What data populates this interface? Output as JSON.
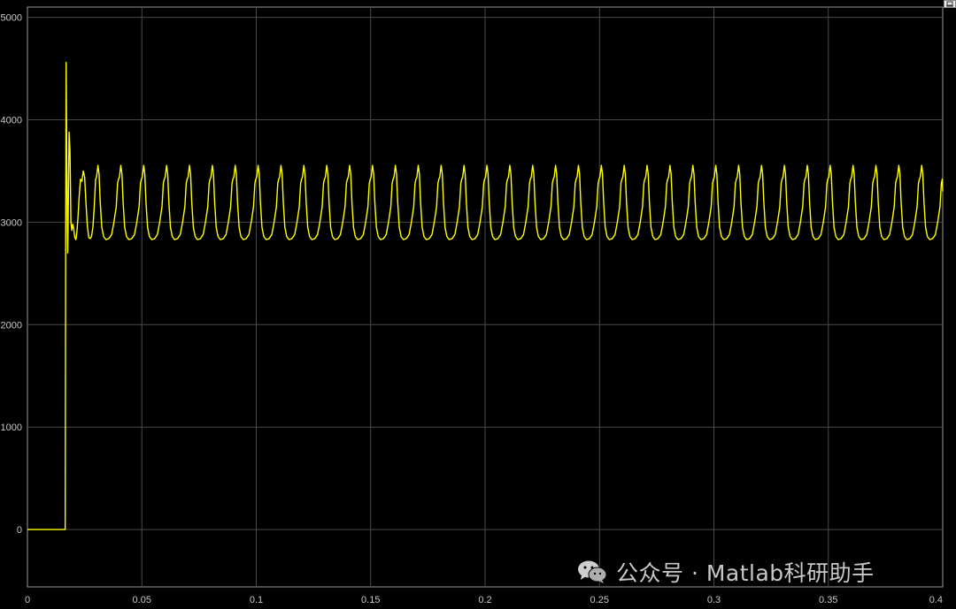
{
  "chart_data": {
    "type": "line",
    "title": "",
    "xlabel": "",
    "ylabel": "",
    "xlim": [
      0,
      0.4
    ],
    "ylim": [
      -560,
      5100
    ],
    "xticks": [
      0,
      0.05,
      0.1,
      0.15,
      0.2,
      0.25,
      0.3,
      0.35,
      0.4
    ],
    "xtick_labels": [
      "0",
      "0.05",
      "0.1",
      "0.15",
      "0.2",
      "0.25",
      "0.3",
      "0.35",
      "0.4"
    ],
    "yticks": [
      0,
      1000,
      2000,
      3000,
      4000,
      5000
    ],
    "ytick_labels": [
      "0",
      "1000",
      "2000",
      "3000",
      "4000",
      "5000"
    ],
    "grid": true,
    "background": "#000000",
    "series": [
      {
        "color": "#ffff00",
        "x": [
          0,
          0.0165,
          0.0167,
          0.0169,
          0.0171,
          0.0174,
          0.0176,
          0.0179,
          0.0182,
          0.0186,
          0.019,
          0.0194,
          0.0198,
          0.0202,
          0.0207,
          0.0212,
          0.0216,
          0.0221,
          0.0226,
          0.0232,
          0.0238,
          0.0244,
          0.025,
          0.0256,
          0.0262,
          0.0268,
          0.0274,
          0.028,
          0.0286,
          0.0292,
          0.0298
        ],
        "y": [
          0,
          0,
          2600,
          4560,
          3900,
          3050,
          2700,
          3250,
          3880,
          3700,
          3000,
          2920,
          2980,
          2940,
          2850,
          2830,
          2900,
          3050,
          3250,
          3420,
          3400,
          3500,
          3440,
          3180,
          2960,
          2850,
          2840,
          2860,
          2950,
          3150,
          3420
        ]
      }
    ],
    "steady_state": {
      "t_start": 0.0298,
      "t_end": 0.4,
      "period": 0.01,
      "y_min": 2830,
      "y_shoulder": 3420,
      "y_peak": 3555,
      "y_mid": 3000
    }
  },
  "watermark": {
    "text": "公众号 · Matlab科研助手",
    "icon": "wechat-icon"
  },
  "controls": {
    "restore_icon": "restore-icon"
  }
}
